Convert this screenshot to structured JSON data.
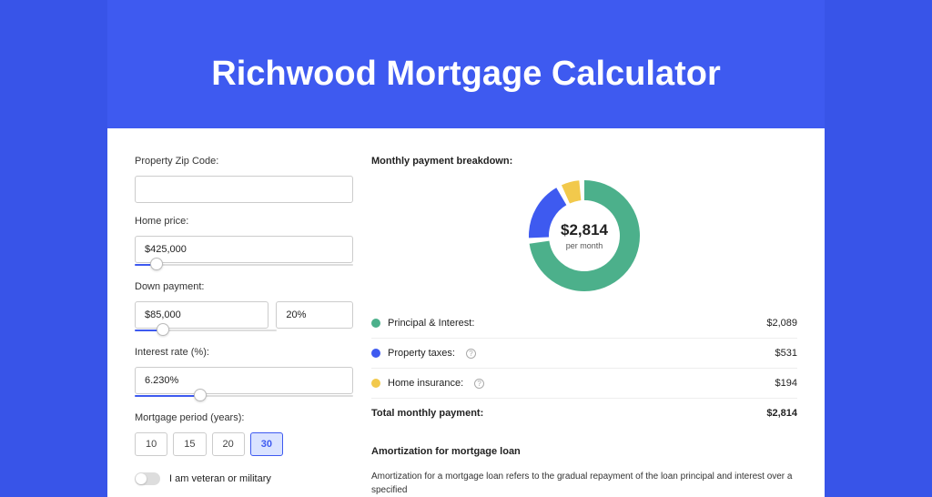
{
  "title": "Richwood Mortgage Calculator",
  "form": {
    "zip_label": "Property Zip Code:",
    "zip_value": "",
    "home_price_label": "Home price:",
    "home_price_value": "$425,000",
    "home_price_slider_pct": 10,
    "down_payment_label": "Down payment:",
    "down_payment_value": "$85,000",
    "down_payment_pct_value": "20%",
    "down_payment_slider_pct": 20,
    "interest_label": "Interest rate (%):",
    "interest_value": "6.230%",
    "interest_slider_pct": 30,
    "period_label": "Mortgage period (years):",
    "periods": [
      "10",
      "15",
      "20",
      "30"
    ],
    "period_active_index": 3,
    "veteran_label": "I am veteran or military"
  },
  "breakdown": {
    "heading": "Monthly payment breakdown:",
    "donut_amount": "$2,814",
    "donut_sub": "per month",
    "items": [
      {
        "label": "Principal & Interest:",
        "value": "$2,089",
        "color": "#4cb08b",
        "has_info": false
      },
      {
        "label": "Property taxes:",
        "value": "$531",
        "color": "#3e5af0",
        "has_info": true
      },
      {
        "label": "Home insurance:",
        "value": "$194",
        "color": "#f2c94c",
        "has_info": true
      }
    ],
    "total_label": "Total monthly payment:",
    "total_value": "$2,814"
  },
  "chart_data": {
    "type": "pie",
    "title": "Monthly payment breakdown",
    "series": [
      {
        "name": "Principal & Interest",
        "value": 2089,
        "color": "#4cb08b"
      },
      {
        "name": "Property taxes",
        "value": 531,
        "color": "#3e5af0"
      },
      {
        "name": "Home insurance",
        "value": 194,
        "color": "#f2c94c"
      }
    ],
    "total": 2814,
    "center_label": "$2,814 per month"
  },
  "amort": {
    "title": "Amortization for mortgage loan",
    "text": "Amortization for a mortgage loan refers to the gradual repayment of the loan principal and interest over a specified"
  }
}
